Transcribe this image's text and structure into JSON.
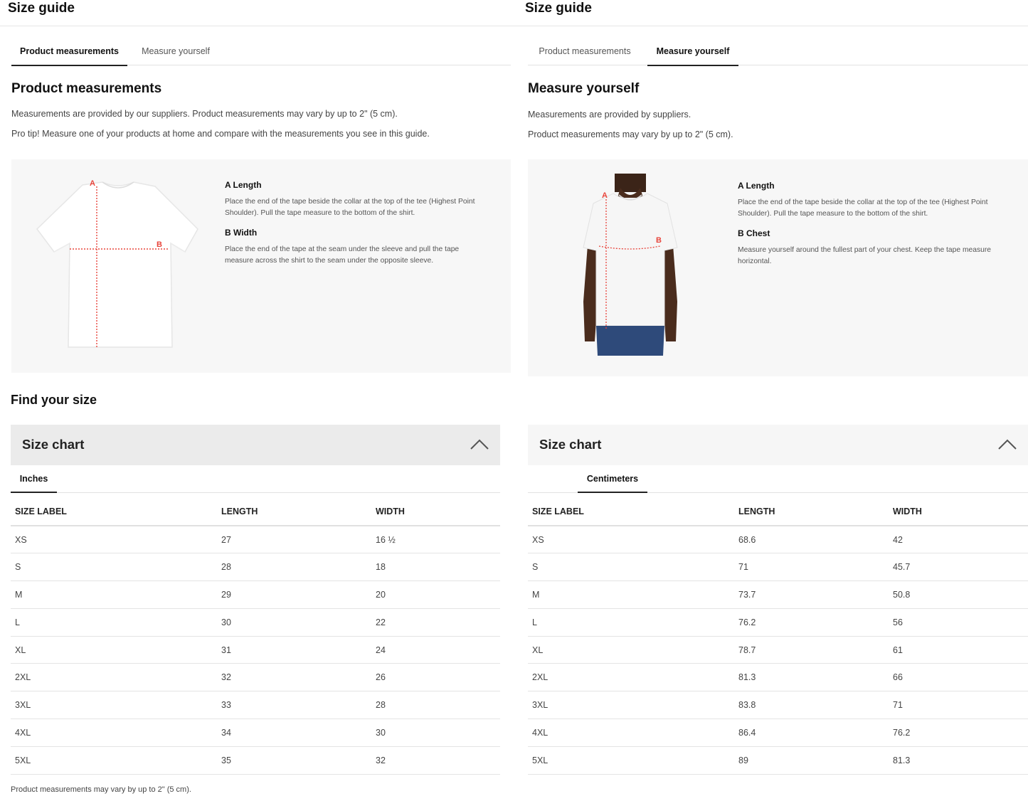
{
  "left": {
    "guide_title": "Size guide",
    "tabs": [
      {
        "label": "Product measurements",
        "active": true
      },
      {
        "label": "Measure yourself",
        "active": false
      }
    ],
    "section_title": "Product measurements",
    "paragraphs": [
      "Measurements are provided by our suppliers. Product measurements may vary by up to 2\" (5 cm).",
      "Pro tip! Measure one of your products at home and compare with the measurements you see in this guide."
    ],
    "figure_labels": {
      "a": "A",
      "b": "B"
    },
    "measures": [
      {
        "title": "A Length",
        "desc": "Place the end of the tape beside the collar at the top of the tee (Highest Point Shoulder). Pull the tape measure to the bottom of the shirt."
      },
      {
        "title": "B Width",
        "desc": "Place the end of the tape at the seam under the sleeve and pull the tape measure across the shirt to the seam under the opposite sleeve."
      }
    ],
    "find_size": "Find your size",
    "chart_title": "Size chart",
    "unit_tab": "Inches",
    "columns": [
      "SIZE LABEL",
      "LENGTH",
      "WIDTH"
    ],
    "rows": [
      [
        "XS",
        "27",
        "16 ½"
      ],
      [
        "S",
        "28",
        "18"
      ],
      [
        "M",
        "29",
        "20"
      ],
      [
        "L",
        "30",
        "22"
      ],
      [
        "XL",
        "31",
        "24"
      ],
      [
        "2XL",
        "32",
        "26"
      ],
      [
        "3XL",
        "33",
        "28"
      ],
      [
        "4XL",
        "34",
        "30"
      ],
      [
        "5XL",
        "35",
        "32"
      ]
    ],
    "footnote": "Product measurements may vary by up to 2\" (5 cm)."
  },
  "right": {
    "guide_title": "Size guide",
    "tabs": [
      {
        "label": "Product measurements",
        "active": false
      },
      {
        "label": "Measure yourself",
        "active": true
      }
    ],
    "section_title": "Measure yourself",
    "paragraphs": [
      "Measurements are provided by suppliers.",
      "Product measurements may vary by up to 2\" (5 cm)."
    ],
    "figure_labels": {
      "a": "A",
      "b": "B"
    },
    "measures": [
      {
        "title": "A Length",
        "desc": "Place the end of the tape beside the collar at the top of the tee (Highest Point Shoulder). Pull the tape measure to the bottom of the shirt."
      },
      {
        "title": "B Chest",
        "desc": "Measure yourself around the fullest part of your chest. Keep the tape measure horizontal."
      }
    ],
    "chart_title": "Size chart",
    "unit_tab": "Centimeters",
    "columns": [
      "SIZE LABEL",
      "LENGTH",
      "WIDTH"
    ],
    "rows": [
      [
        "XS",
        "68.6",
        "42"
      ],
      [
        "S",
        "71",
        "45.7"
      ],
      [
        "M",
        "73.7",
        "50.8"
      ],
      [
        "L",
        "76.2",
        "56"
      ],
      [
        "XL",
        "78.7",
        "61"
      ],
      [
        "2XL",
        "81.3",
        "66"
      ],
      [
        "3XL",
        "83.8",
        "71"
      ],
      [
        "4XL",
        "86.4",
        "76.2"
      ],
      [
        "5XL",
        "89",
        "81.3"
      ]
    ]
  },
  "colors": {
    "measure_line": "#e8453c",
    "active_tab_border": "#222222"
  }
}
